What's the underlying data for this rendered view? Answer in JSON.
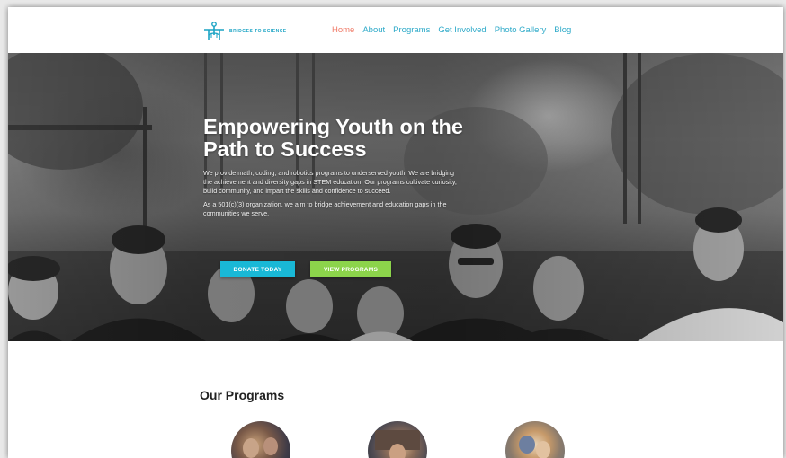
{
  "header": {
    "logo_text": "BRIDGES TO SCIENCE",
    "nav": [
      {
        "label": "Home",
        "active": true
      },
      {
        "label": "About",
        "active": false
      },
      {
        "label": "Programs",
        "active": false
      },
      {
        "label": "Get Involved",
        "active": false
      },
      {
        "label": "Photo Gallery",
        "active": false
      },
      {
        "label": "Blog",
        "active": false
      }
    ]
  },
  "hero": {
    "title": "Empowering Youth on the Path to Success",
    "paragraph1": "We provide math, coding, and robotics programs to underserved youth. We are bridging the achievement and diversity gaps in STEM education. Our programs cultivate curiosity, build community, and impart the skills and confidence to succeed.",
    "paragraph2": "As a 501(c)(3) organization, we aim to bridge achievement and education gaps in the communities we serve.",
    "donate_label": "DONATE TODAY",
    "programs_label": "VIEW PROGRAMS"
  },
  "programs": {
    "title": "Our Programs"
  },
  "colors": {
    "nav_link": "#2eaac9",
    "nav_active": "#f07a67",
    "donate_button": "#19b8d6",
    "programs_button": "#8cd44b",
    "logo": "#1aa3c4"
  },
  "icons": {
    "logo": "bridge-figure-icon"
  }
}
